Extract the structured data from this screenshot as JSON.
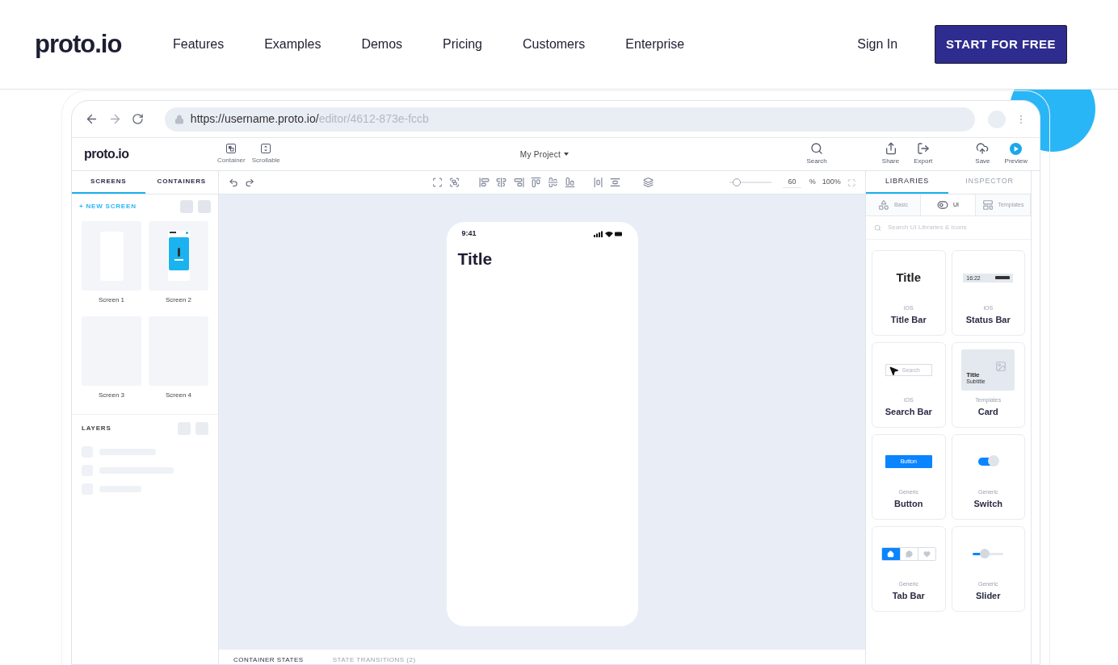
{
  "nav": {
    "logo": "proto.io",
    "links": [
      "Features",
      "Examples",
      "Demos",
      "Pricing",
      "Customers",
      "Enterprise"
    ],
    "sign_in": "Sign In",
    "cta": "START FOR FREE"
  },
  "browser": {
    "url_host": "https://username.proto.io/",
    "url_path": "editor/4612-873e-fccb"
  },
  "editor": {
    "logo": "proto.io",
    "insert_tools": [
      {
        "label": "Container",
        "kind": "container"
      },
      {
        "label": "Scrollable",
        "kind": "scrollable"
      }
    ],
    "project": "My Project",
    "actions": [
      {
        "label": "Search",
        "kind": "search"
      },
      {
        "label": "Share",
        "kind": "share"
      },
      {
        "label": "Export",
        "kind": "export"
      },
      {
        "label": "Save",
        "kind": "save"
      },
      {
        "label": "Preview",
        "kind": "preview"
      }
    ]
  },
  "left_tabs": [
    {
      "label": "SCREENS",
      "selected": true
    },
    {
      "label": "CONTAINERS",
      "selected": false
    }
  ],
  "new_screen": "+ NEW SCREEN",
  "screens": [
    {
      "name": "Screen 1",
      "kind": "blank"
    },
    {
      "name": "Screen 2",
      "kind": "gallery"
    },
    {
      "name": "Screen 3",
      "kind": "empty"
    },
    {
      "name": "Screen 4",
      "kind": "empty"
    }
  ],
  "layers": {
    "title": "LAYERS"
  },
  "zoom": {
    "value": "60",
    "unit": "%",
    "preset": "100%",
    "level": 0.18
  },
  "phone": {
    "time": "9:41",
    "title": "Title"
  },
  "right_tabs": [
    {
      "label": "LIBRARIES",
      "selected": true
    },
    {
      "label": "INSPECTOR",
      "selected": false
    }
  ],
  "library_tabs": [
    {
      "label": "Basic",
      "kind": "basic",
      "selected": false
    },
    {
      "label": "UI",
      "kind": "ui",
      "selected": true
    },
    {
      "label": "Templates",
      "kind": "templates",
      "selected": false
    }
  ],
  "library_search": {
    "placeholder": "Search UI Libraries & Icons"
  },
  "components": [
    {
      "kind": "title",
      "category": "iOS",
      "name": "Title Bar",
      "preview_text": "Title"
    },
    {
      "kind": "status",
      "category": "iOS",
      "name": "Status Bar",
      "preview_text": "16:22"
    },
    {
      "kind": "search",
      "category": "iOS",
      "name": "Search Bar",
      "preview_text": "Search"
    },
    {
      "kind": "card",
      "category": "Templates",
      "name": "Card",
      "preview_text": "Title",
      "preview_subtext": "Subtitle"
    },
    {
      "kind": "button",
      "category": "Generic",
      "name": "Button",
      "preview_text": "Button"
    },
    {
      "kind": "switch",
      "category": "Generic",
      "name": "Switch",
      "on": true
    },
    {
      "kind": "tabbar",
      "category": "Generic",
      "name": "Tab Bar",
      "tabs": [
        {
          "kind": "home",
          "selected": true
        },
        {
          "kind": "chat",
          "selected": false
        },
        {
          "kind": "heart",
          "selected": false
        }
      ]
    },
    {
      "kind": "slider",
      "category": "Generic",
      "name": "Slider",
      "level": 0.4
    }
  ],
  "bottom_tabs": [
    {
      "label": "CONTAINER STATES",
      "selected": true
    },
    {
      "label": "STATE TRANSITIONS (2)",
      "selected": false
    }
  ]
}
